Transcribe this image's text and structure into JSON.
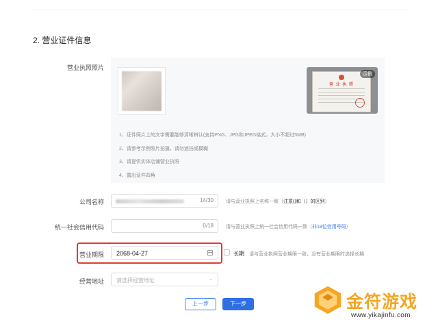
{
  "section": {
    "title": "2. 营业证件信息"
  },
  "license_photo": {
    "label": "营业执照照片",
    "example_badge": "示例",
    "example_title": "营 业 执 照",
    "tips": [
      "1、证件照片上的文字需要能够清晰辨认(支持PNG、JPG和JPEG格式，大小不超过5MB)",
      "2、请参考示例照片拍摄，请勿遮挡或模糊",
      "3、请提供实体店铺营业执照",
      "4、露出证件四角"
    ]
  },
  "company_name": {
    "label": "公司名称",
    "counter": "14/30",
    "hint_pre": "请与营业执照上名称一致（",
    "hint_strong": "注意()和（）的区别",
    "hint_post": "）"
  },
  "credit_code": {
    "label": "统一社会信用代码",
    "counter": "0/18",
    "hint_pre": "请与营业执照上统一社会信用代码一致（",
    "hint_link": "非18位信用号码",
    "hint_post": "）"
  },
  "business_term": {
    "label": "营业期限",
    "value": "2068-04-27",
    "long_term_label": "长期",
    "hint": "请与营业执照营业期限一致，没有营业期限时选择长期"
  },
  "address": {
    "label": "经营地址",
    "placeholder": "请选择经营地址"
  },
  "buttons": {
    "prev": "上一步",
    "next": "下一步"
  },
  "watermark": {
    "text": "金符游戏",
    "url": "www.yikajinfu.com"
  },
  "colors": {
    "primary": "#2f6fe4",
    "highlight_border": "#e03a34",
    "watermark": "#f5a623"
  }
}
